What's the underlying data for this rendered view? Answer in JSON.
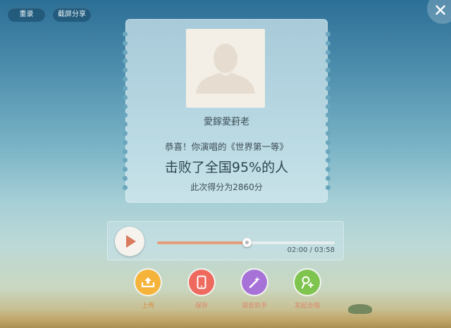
{
  "top_buttons": {
    "rerecord_label": "重录",
    "share_label": "截屏分享"
  },
  "close": {
    "label": "✕"
  },
  "card": {
    "username": "愛鎵愛葑老",
    "congrats": "恭喜！你演唱的《世界第一等》",
    "beat": "击败了全国95%的人",
    "score": "此次得分为2860分"
  },
  "player": {
    "elapsed": "02:00",
    "total": "03:58",
    "time_text": "02:00 / 03:58",
    "progress_fraction": 0.504,
    "accent_color": "#e89b79"
  },
  "actions": [
    {
      "label": "上传",
      "icon": "upload-icon",
      "color": "#f5b33a",
      "label_color": "#d98a3a"
    },
    {
      "label": "保存",
      "icon": "phone-icon",
      "color": "#ee6a5e",
      "label_color": "#d98a6a"
    },
    {
      "label": "调音助手",
      "icon": "magic-wand-icon",
      "color": "#a772d8",
      "label_color": "#d98a6a"
    },
    {
      "label": "发起合唱",
      "icon": "mic-plus-icon",
      "color": "#7fc44f",
      "label_color": "#d98a6a"
    }
  ]
}
